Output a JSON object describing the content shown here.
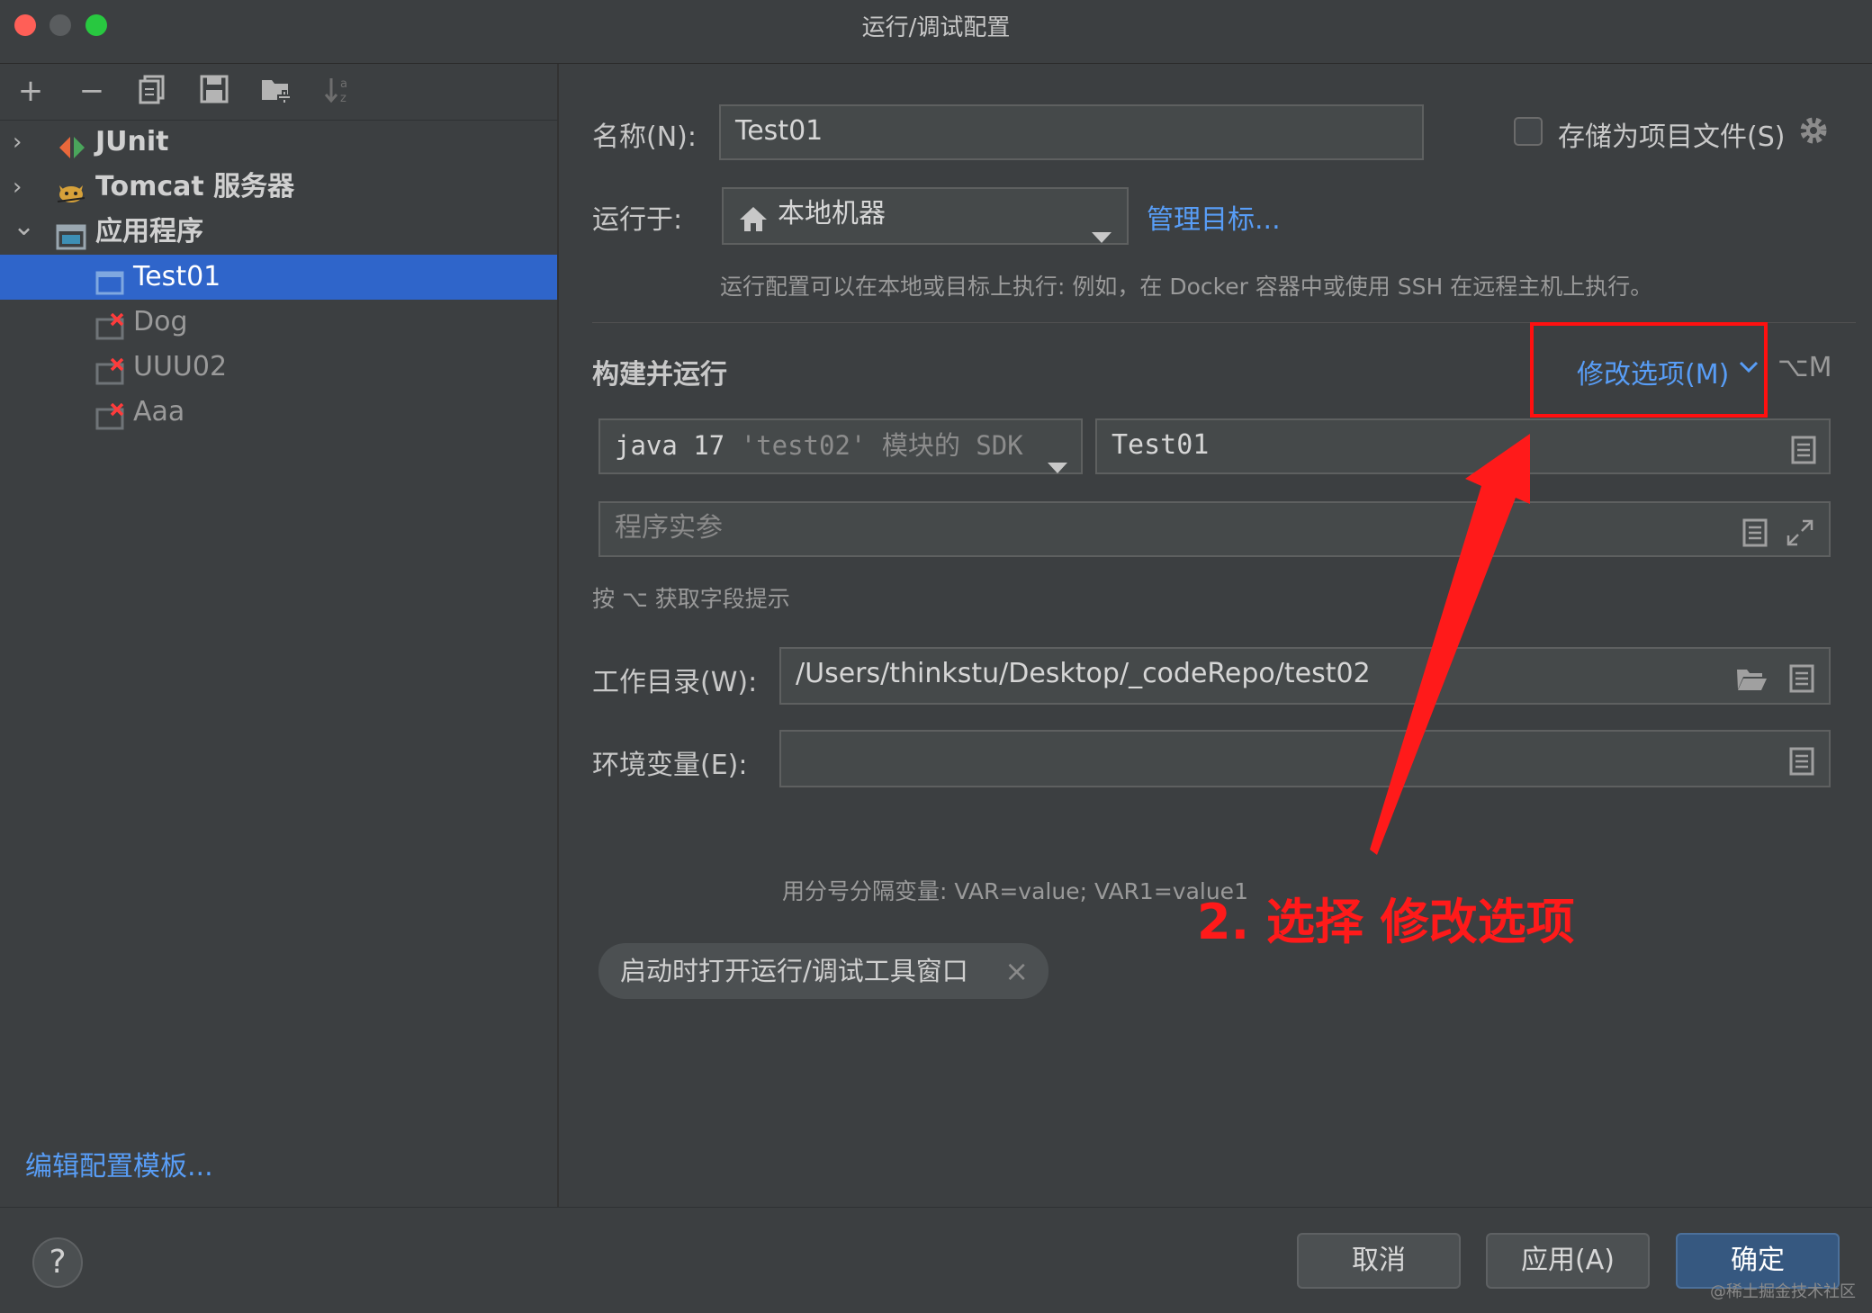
{
  "window": {
    "title": "运行/调试配置"
  },
  "toolbar": {
    "add": "+",
    "remove": "−"
  },
  "tree": {
    "items": [
      {
        "label": "JUnit",
        "expanded": false,
        "icon": "junit-icon"
      },
      {
        "label": "Tomcat 服务器",
        "expanded": false,
        "icon": "tomcat-icon"
      },
      {
        "label": "应用程序",
        "expanded": true,
        "icon": "application-icon"
      }
    ],
    "children": [
      {
        "label": "Test01",
        "selected": true
      },
      {
        "label": "Dog",
        "error": true
      },
      {
        "label": "UUU02",
        "error": true
      },
      {
        "label": "Aaa",
        "error": true
      }
    ],
    "expand_collapsed": "›",
    "expand_open": "⌄"
  },
  "edit_templates": "编辑配置模板...",
  "form": {
    "name_label": "名称(N):",
    "name_value": "Test01",
    "store_as_file": "存储为项目文件(S)",
    "run_on_label": "运行于:",
    "run_on_value": "本地机器",
    "manage_targets": "管理目标...",
    "run_on_hint": "运行配置可以在本地或目标上执行: 例如，在 Docker 容器中或使用 SSH 在远程主机上执行。",
    "build_run_title": "构建并运行",
    "modify_options": "修改选项(M)",
    "modify_shortcut": "⌥M",
    "sdk_prefix": "java 17 ",
    "sdk_suffix": "'test02' 模块的 SDK",
    "main_class": "Test01",
    "program_args_placeholder": "程序实参",
    "field_hint": "按 ⌥ 获取字段提示",
    "workdir_label": "工作目录(W):",
    "workdir_value": "/Users/thinkstu/Desktop/_codeRepo/test02",
    "env_label": "环境变量(E):",
    "env_value": "",
    "env_hint": "用分号分隔变量: VAR=value; VAR1=value1",
    "tag_label": "启动时打开运行/调试工具窗口",
    "tag_close": "×"
  },
  "buttons": {
    "help": "?",
    "cancel": "取消",
    "apply": "应用(A)",
    "ok": "确定"
  },
  "annotation": {
    "text": "2. 选择 修改选项"
  },
  "watermark": "@稀土掘金技术社区"
}
